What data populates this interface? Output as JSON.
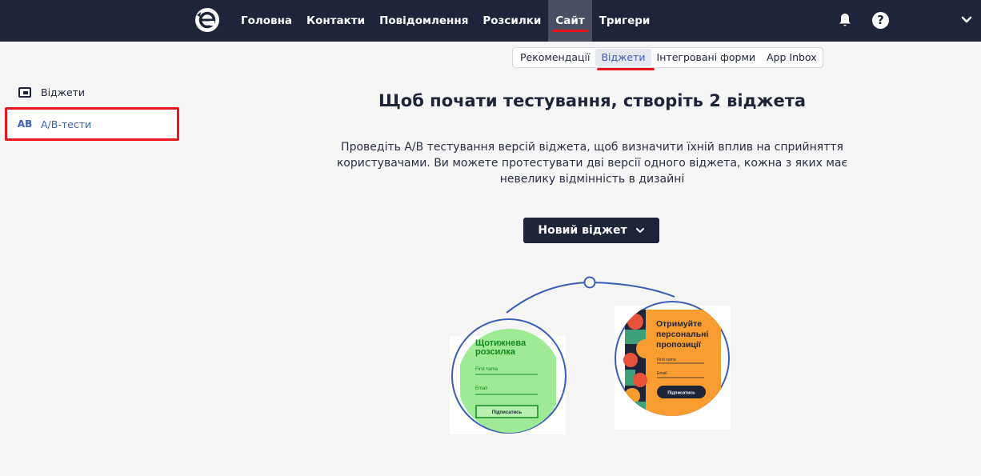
{
  "topnav": {
    "items": [
      {
        "label": "Головна"
      },
      {
        "label": "Контакти"
      },
      {
        "label": "Повідомлення"
      },
      {
        "label": "Розсилки"
      },
      {
        "label": "Сайт"
      },
      {
        "label": "Тригери"
      }
    ],
    "active_index": 4,
    "help_glyph": "?"
  },
  "subtabs": {
    "items": [
      {
        "label": "Рекомендації"
      },
      {
        "label": "Віджети"
      },
      {
        "label": "Інтегровані форми"
      },
      {
        "label": "App Inbox"
      }
    ],
    "active_index": 1
  },
  "sidebar": {
    "items": [
      {
        "label": "Віджети",
        "icon": "widget-icon"
      },
      {
        "label": "A/B-тести",
        "icon": "ab-icon",
        "icon_text": "AB"
      }
    ],
    "active_index": 1
  },
  "main": {
    "headline": "Щоб почати тестування, створіть 2 віджета",
    "description": "Проведіть A/B тестування версій віджета, щоб визначити їхній вплив на сприйняття користувачами. Ви можете протестувати дві версії одного віджета, кожна з яких має невелику відмінність в дизайні",
    "new_widget_button": "Новий віджет"
  },
  "illustration": {
    "card_a": {
      "title_line1": "Щотижнева",
      "title_line2": "розсилка",
      "field1": "First name",
      "field2": "Email",
      "button": "Підписатись"
    },
    "card_b": {
      "title_line1": "Отримуйте",
      "title_line2": "персональні",
      "title_line3": "пропозиції",
      "field1": "First name",
      "field2": "Email",
      "button": "Підписатись"
    }
  },
  "colors": {
    "topbar": "#1e2538",
    "accent_red": "#e8141e",
    "link_blue": "#3b5db8",
    "card_green": "#9eea95",
    "card_orange": "#f99d31"
  }
}
